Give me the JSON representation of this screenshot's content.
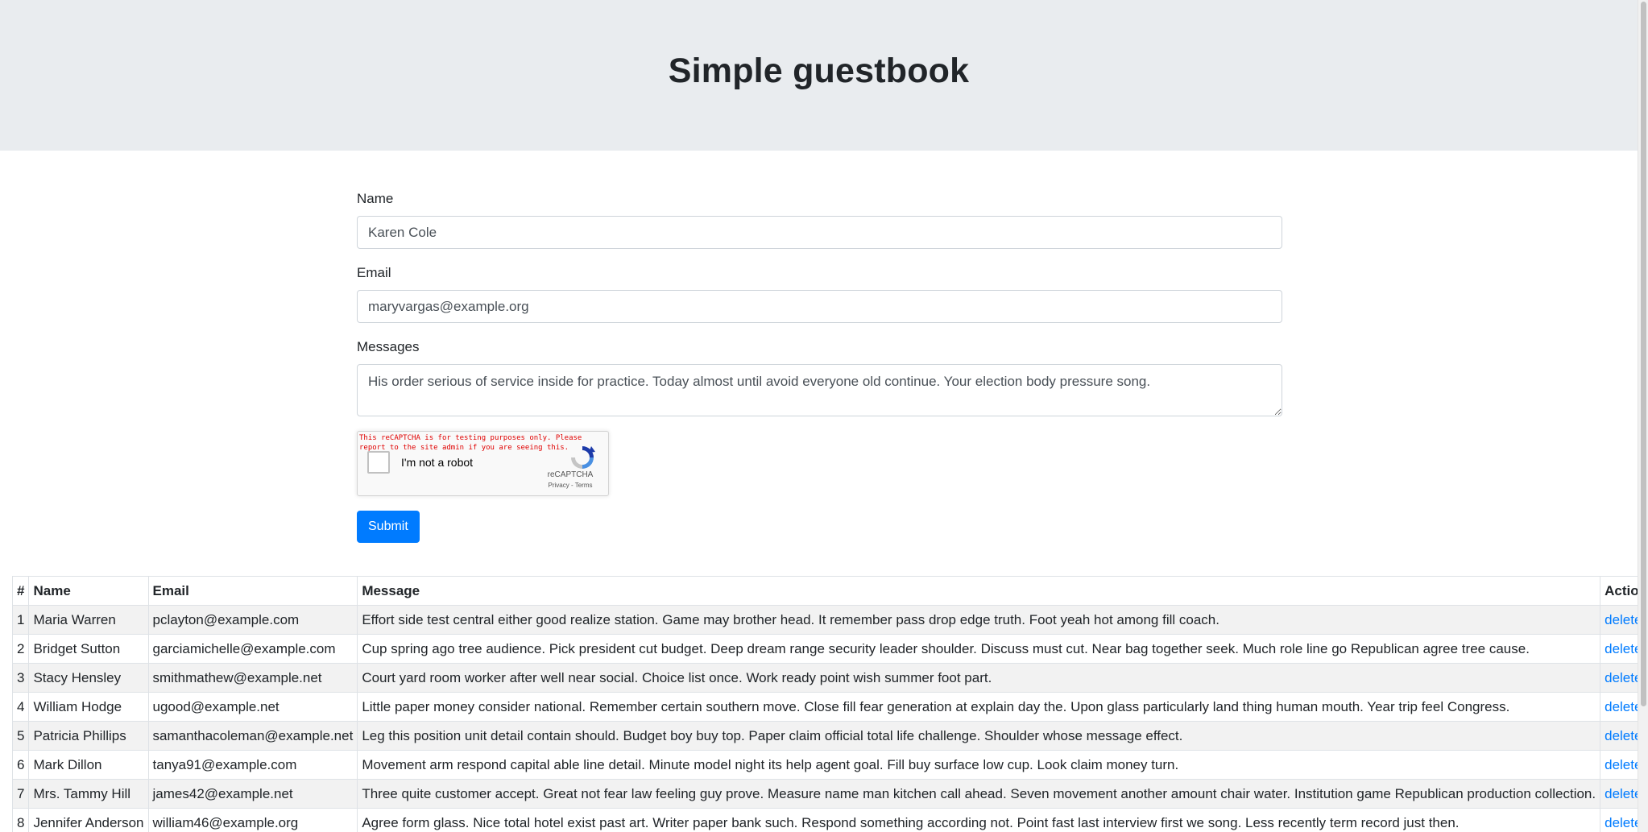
{
  "header": {
    "title": "Simple guestbook"
  },
  "form": {
    "name_label": "Name",
    "name_value": "Karen Cole",
    "email_label": "Email",
    "email_value": "maryvargas@example.org",
    "messages_label": "Messages",
    "messages_value": "His order serious of service inside for practice. Today almost until avoid everyone old continue. Your election body pressure song.",
    "submit_label": "Submit"
  },
  "recaptcha": {
    "warning": "This reCAPTCHA is for testing purposes only. Please report to the site admin if you are seeing this.",
    "checkbox_label": "I'm not a robot",
    "brand": "reCAPTCHA",
    "links": "Privacy - Terms"
  },
  "table": {
    "headers": [
      "#",
      "Name",
      "Email",
      "Message",
      "Action"
    ],
    "rows": [
      {
        "id": "1",
        "name": "Maria Warren",
        "email": "pclayton@example.com",
        "message": "Effort side test central either good realize station. Game may brother head. It remember pass drop edge truth. Foot yeah hot among fill coach.",
        "action": "delete"
      },
      {
        "id": "2",
        "name": "Bridget Sutton",
        "email": "garciamichelle@example.com",
        "message": "Cup spring ago tree audience. Pick president cut budget. Deep dream range security leader shoulder. Discuss must cut. Near bag together seek. Much role line go Republican agree tree cause.",
        "action": "delete"
      },
      {
        "id": "3",
        "name": "Stacy Hensley",
        "email": "smithmathew@example.net",
        "message": "Court yard room worker after well near social. Choice list once. Work ready point wish summer foot part.",
        "action": "delete"
      },
      {
        "id": "4",
        "name": "William Hodge",
        "email": "ugood@example.net",
        "message": "Little paper money consider national. Remember certain southern move. Close fill fear generation at explain day the. Upon glass particularly land thing human mouth. Year trip feel Congress.",
        "action": "delete"
      },
      {
        "id": "5",
        "name": "Patricia Phillips",
        "email": "samanthacoleman@example.net",
        "message": "Leg this position unit detail contain should. Budget boy buy top. Paper claim official total life challenge. Shoulder whose message effect.",
        "action": "delete"
      },
      {
        "id": "6",
        "name": "Mark Dillon",
        "email": "tanya91@example.com",
        "message": "Movement arm respond capital able line detail. Minute model night its help agent goal. Fill buy surface low cup. Look claim money turn.",
        "action": "delete"
      },
      {
        "id": "7",
        "name": "Mrs. Tammy Hill",
        "email": "james42@example.net",
        "message": "Three quite customer accept. Great not fear law feeling guy prove. Measure name man kitchen call ahead. Seven movement another amount chair water. Institution game Republican production collection.",
        "action": "delete"
      },
      {
        "id": "8",
        "name": "Jennifer Anderson",
        "email": "william46@example.org",
        "message": "Agree form glass. Nice total hotel exist past art. Writer paper bank such. Respond something according not. Point fast last interview first we song. Less recently term record just then.",
        "action": "delete"
      }
    ]
  }
}
